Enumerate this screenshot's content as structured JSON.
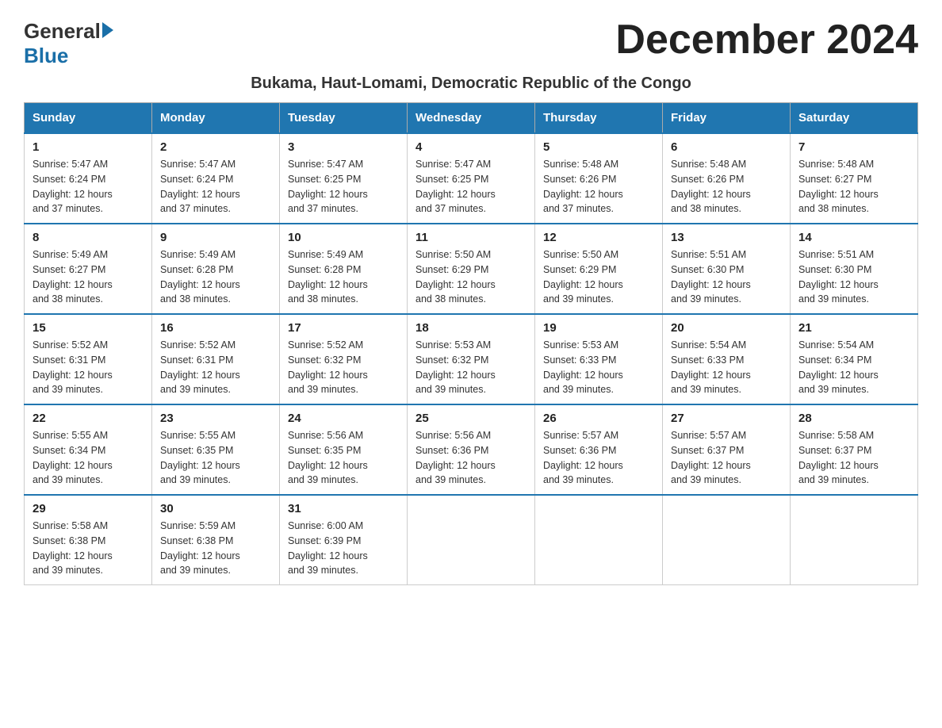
{
  "header": {
    "logo_general": "General",
    "logo_blue": "Blue",
    "month_title": "December 2024",
    "location": "Bukama, Haut-Lomami, Democratic Republic of the Congo"
  },
  "days_of_week": [
    "Sunday",
    "Monday",
    "Tuesday",
    "Wednesday",
    "Thursday",
    "Friday",
    "Saturday"
  ],
  "weeks": [
    [
      {
        "day": "1",
        "sunrise": "5:47 AM",
        "sunset": "6:24 PM",
        "daylight": "12 hours and 37 minutes."
      },
      {
        "day": "2",
        "sunrise": "5:47 AM",
        "sunset": "6:24 PM",
        "daylight": "12 hours and 37 minutes."
      },
      {
        "day": "3",
        "sunrise": "5:47 AM",
        "sunset": "6:25 PM",
        "daylight": "12 hours and 37 minutes."
      },
      {
        "day": "4",
        "sunrise": "5:47 AM",
        "sunset": "6:25 PM",
        "daylight": "12 hours and 37 minutes."
      },
      {
        "day": "5",
        "sunrise": "5:48 AM",
        "sunset": "6:26 PM",
        "daylight": "12 hours and 37 minutes."
      },
      {
        "day": "6",
        "sunrise": "5:48 AM",
        "sunset": "6:26 PM",
        "daylight": "12 hours and 38 minutes."
      },
      {
        "day": "7",
        "sunrise": "5:48 AM",
        "sunset": "6:27 PM",
        "daylight": "12 hours and 38 minutes."
      }
    ],
    [
      {
        "day": "8",
        "sunrise": "5:49 AM",
        "sunset": "6:27 PM",
        "daylight": "12 hours and 38 minutes."
      },
      {
        "day": "9",
        "sunrise": "5:49 AM",
        "sunset": "6:28 PM",
        "daylight": "12 hours and 38 minutes."
      },
      {
        "day": "10",
        "sunrise": "5:49 AM",
        "sunset": "6:28 PM",
        "daylight": "12 hours and 38 minutes."
      },
      {
        "day": "11",
        "sunrise": "5:50 AM",
        "sunset": "6:29 PM",
        "daylight": "12 hours and 38 minutes."
      },
      {
        "day": "12",
        "sunrise": "5:50 AM",
        "sunset": "6:29 PM",
        "daylight": "12 hours and 39 minutes."
      },
      {
        "day": "13",
        "sunrise": "5:51 AM",
        "sunset": "6:30 PM",
        "daylight": "12 hours and 39 minutes."
      },
      {
        "day": "14",
        "sunrise": "5:51 AM",
        "sunset": "6:30 PM",
        "daylight": "12 hours and 39 minutes."
      }
    ],
    [
      {
        "day": "15",
        "sunrise": "5:52 AM",
        "sunset": "6:31 PM",
        "daylight": "12 hours and 39 minutes."
      },
      {
        "day": "16",
        "sunrise": "5:52 AM",
        "sunset": "6:31 PM",
        "daylight": "12 hours and 39 minutes."
      },
      {
        "day": "17",
        "sunrise": "5:52 AM",
        "sunset": "6:32 PM",
        "daylight": "12 hours and 39 minutes."
      },
      {
        "day": "18",
        "sunrise": "5:53 AM",
        "sunset": "6:32 PM",
        "daylight": "12 hours and 39 minutes."
      },
      {
        "day": "19",
        "sunrise": "5:53 AM",
        "sunset": "6:33 PM",
        "daylight": "12 hours and 39 minutes."
      },
      {
        "day": "20",
        "sunrise": "5:54 AM",
        "sunset": "6:33 PM",
        "daylight": "12 hours and 39 minutes."
      },
      {
        "day": "21",
        "sunrise": "5:54 AM",
        "sunset": "6:34 PM",
        "daylight": "12 hours and 39 minutes."
      }
    ],
    [
      {
        "day": "22",
        "sunrise": "5:55 AM",
        "sunset": "6:34 PM",
        "daylight": "12 hours and 39 minutes."
      },
      {
        "day": "23",
        "sunrise": "5:55 AM",
        "sunset": "6:35 PM",
        "daylight": "12 hours and 39 minutes."
      },
      {
        "day": "24",
        "sunrise": "5:56 AM",
        "sunset": "6:35 PM",
        "daylight": "12 hours and 39 minutes."
      },
      {
        "day": "25",
        "sunrise": "5:56 AM",
        "sunset": "6:36 PM",
        "daylight": "12 hours and 39 minutes."
      },
      {
        "day": "26",
        "sunrise": "5:57 AM",
        "sunset": "6:36 PM",
        "daylight": "12 hours and 39 minutes."
      },
      {
        "day": "27",
        "sunrise": "5:57 AM",
        "sunset": "6:37 PM",
        "daylight": "12 hours and 39 minutes."
      },
      {
        "day": "28",
        "sunrise": "5:58 AM",
        "sunset": "6:37 PM",
        "daylight": "12 hours and 39 minutes."
      }
    ],
    [
      {
        "day": "29",
        "sunrise": "5:58 AM",
        "sunset": "6:38 PM",
        "daylight": "12 hours and 39 minutes."
      },
      {
        "day": "30",
        "sunrise": "5:59 AM",
        "sunset": "6:38 PM",
        "daylight": "12 hours and 39 minutes."
      },
      {
        "day": "31",
        "sunrise": "6:00 AM",
        "sunset": "6:39 PM",
        "daylight": "12 hours and 39 minutes."
      },
      null,
      null,
      null,
      null
    ]
  ],
  "labels": {
    "sunrise": "Sunrise:",
    "sunset": "Sunset:",
    "daylight": "Daylight:"
  }
}
